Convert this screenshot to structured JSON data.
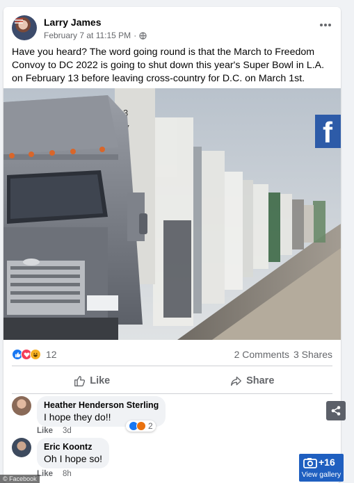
{
  "post": {
    "author": "Larry James",
    "timestamp": "February 7 at 11:15 PM",
    "separator": "·",
    "text": "Have you heard?  The word going round is that the March to Freedom Convoy to DC 2022 is going to shut down this year's Super Bowl in L.A. on February 13 before leaving cross-country for D.C. on March 1st.",
    "image_icons": {
      "brand": "facebook-logo"
    }
  },
  "stats": {
    "reaction_count": "12",
    "comments": "2 Comments",
    "shares": "3 Shares",
    "reaction_icons": [
      "like-icon",
      "love-icon",
      "haha-icon"
    ]
  },
  "actions": {
    "like_label": "Like",
    "share_label": "Share"
  },
  "comments": [
    {
      "name": "Heather Henderson Sterling",
      "text": "I hope they do!!",
      "like_label": "Like",
      "age": "3d",
      "reaction_count": "2"
    },
    {
      "name": "Eric Koontz",
      "text": "Oh I hope so!",
      "like_label": "Like",
      "age": "8h"
    }
  ],
  "gallery": {
    "count": "+16",
    "label": "View gallery"
  },
  "credit": "© Facebook",
  "colors": {
    "facebook_blue": "#1877f2",
    "like_blue": "#1877f2",
    "love_red": "#f33e58",
    "haha_yellow": "#f7b125",
    "gallery_blue": "#1f5fc0",
    "muted_text": "#65676b"
  }
}
